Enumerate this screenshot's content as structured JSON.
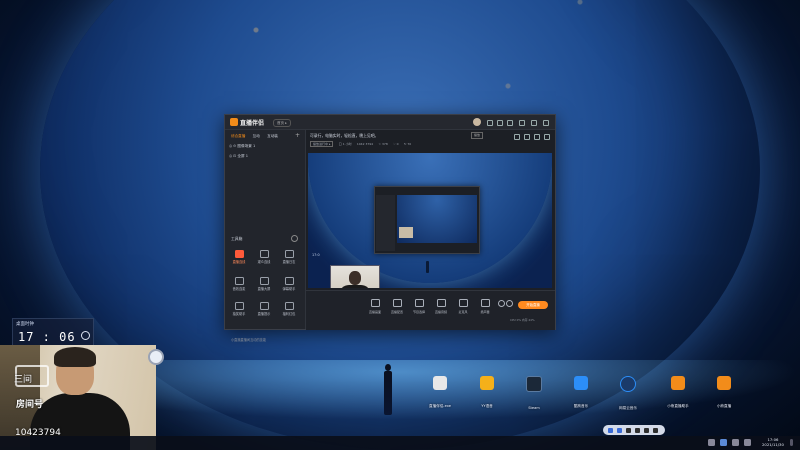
{
  "window": {
    "app_name": "直播伴侣",
    "version_badge": "首页 ▸",
    "left_tabs": [
      "综合直播",
      "互动",
      "互动装"
    ],
    "scenes": [
      "◎ ⊙ 图像场景 1",
      "◎ ⊡ 全屏 1"
    ],
    "tools_title": "工具箱",
    "tools": [
      {
        "label": "直播连线",
        "hot": true
      },
      {
        "label": "观众连线",
        "hot": false
      },
      {
        "label": "直播日志",
        "hot": false
      },
      {
        "label": "音效连麦",
        "hot": false
      },
      {
        "label": "直播大屏",
        "hot": false
      },
      {
        "label": "弹幕助手",
        "hot": false
      },
      {
        "label": "抽奖助手",
        "hot": false
      },
      {
        "label": "直播提示",
        "hot": false
      },
      {
        "label": "福利红包",
        "hot": false
      }
    ],
    "footer_note": "小直播直播间互动的技能",
    "marquee": "可录行，电脑实时，轻松直，晚上见吧。",
    "marquee_btn": "播放",
    "stats": [
      "播放进行中 ▸",
      "口 1 小时",
      "1042 3794",
      "☆ 378",
      "♡ 0",
      "↻ 70"
    ],
    "preview_time": "17:0",
    "controls": [
      "直播画面",
      "直播配置",
      "节目选择",
      "直播音频",
      "麦克风",
      "扬声器"
    ],
    "live_button": "开始直播",
    "cpu_text": "CPU 0%  内存 44%"
  },
  "clock": {
    "label": "桌面时钟",
    "time": "17 : 06"
  },
  "webcam": {
    "channel_label": "三间",
    "room_label": "房间号",
    "room_id": "10423794"
  },
  "desktop_icons": [
    {
      "label": "直播伴侣.exe",
      "color": "#e8e8e8"
    },
    {
      "label": "YY语音",
      "color": "#f5b01a"
    },
    {
      "label": "Steam",
      "color": "#1b2838"
    },
    {
      "label": "酷狗音乐",
      "color": "#2c8ef8"
    },
    {
      "label": "网易云音乐",
      "color": "#2c8ef8"
    },
    {
      "label": "小熊直播助手",
      "color": "#f28c1a"
    },
    {
      "label": "小熊直播",
      "color": "#f28c1a"
    }
  ],
  "taskbar": {
    "time": "17:06",
    "date": "2021/11/30"
  }
}
